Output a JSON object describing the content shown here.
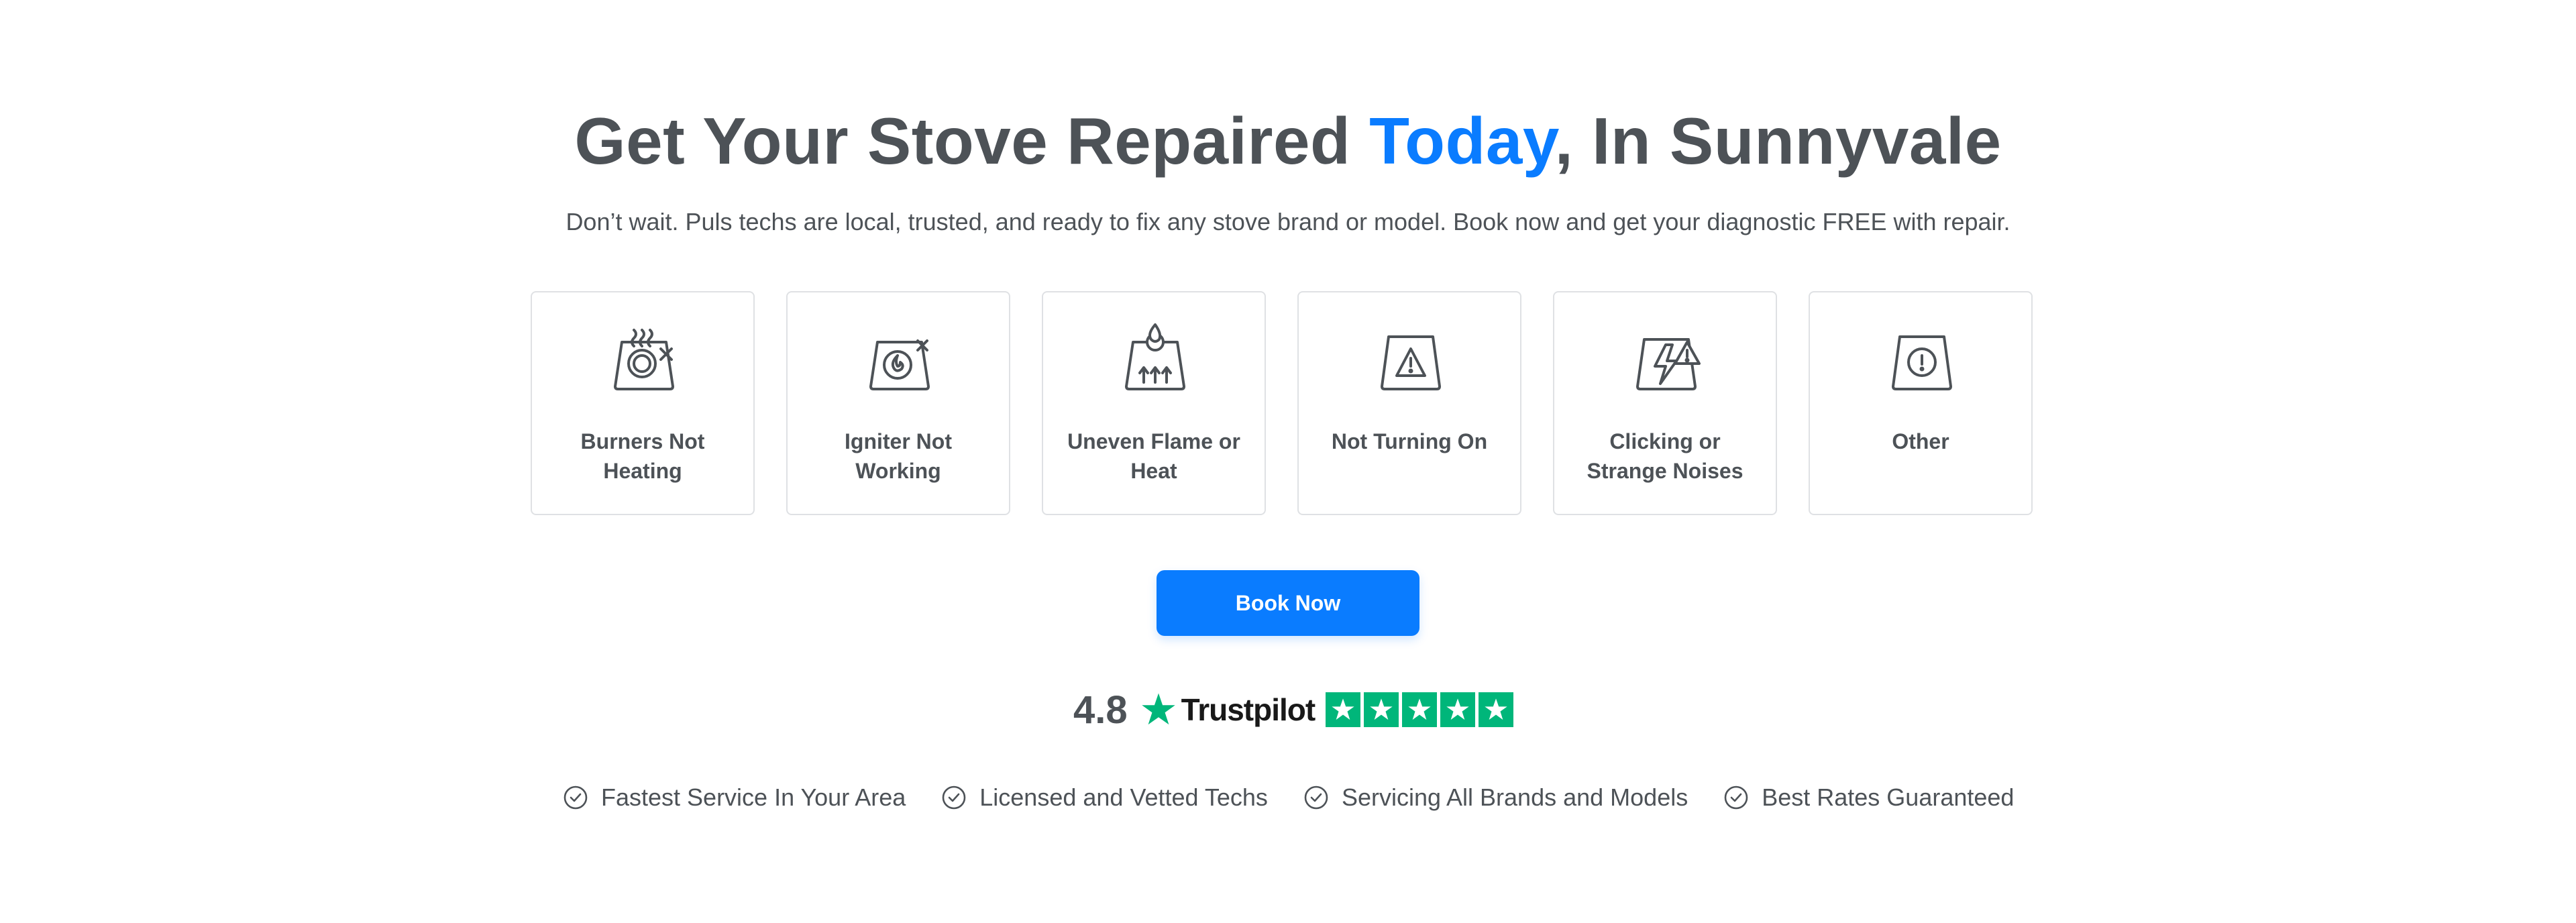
{
  "headline": {
    "before": "Get Your Stove Repaired ",
    "accent": "Today",
    "after": ", In Sunnyvale"
  },
  "subhead": "Don’t wait. Puls techs are local, trusted, and ready to fix any stove brand or model. Book now and get your diagnostic FREE with repair.",
  "issues": [
    {
      "icon": "burner-not-heating-icon",
      "label": "Burners Not Heating"
    },
    {
      "icon": "igniter-not-working-icon",
      "label": "Igniter Not Working"
    },
    {
      "icon": "uneven-flame-icon",
      "label": "Uneven Flame or Heat"
    },
    {
      "icon": "warning-triangle-icon",
      "label": "Not Turning On"
    },
    {
      "icon": "lightning-warning-icon",
      "label": "Clicking or Strange Noises"
    },
    {
      "icon": "exclamation-circle-icon",
      "label": "Other"
    }
  ],
  "cta": {
    "label": "Book Now"
  },
  "rating": {
    "value": "4.8",
    "provider": "Trustpilot",
    "stars": 5,
    "brand_color": "#00b67a"
  },
  "features": [
    "Fastest Service In Your Area",
    "Licensed and Vetted Techs",
    "Servicing All Brands and Models",
    "Best Rates Guaranteed"
  ],
  "colors": {
    "accent": "#0a7cff",
    "text": "#4d5257",
    "card_border": "#dfe1e4"
  }
}
